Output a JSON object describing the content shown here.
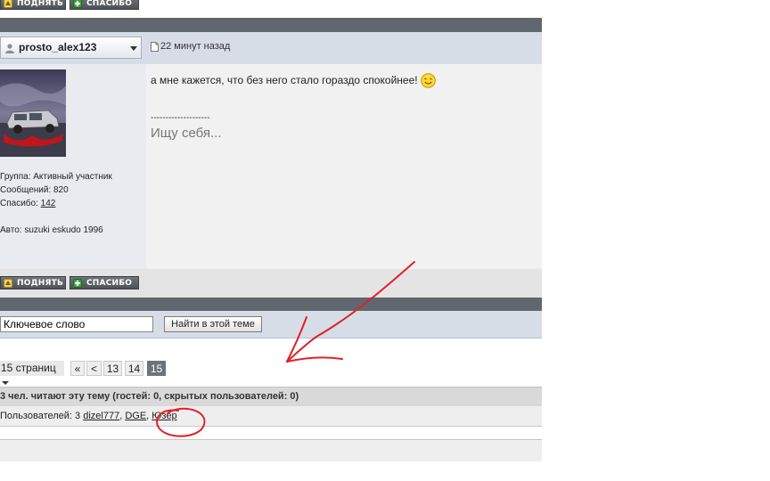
{
  "post_top": {
    "raise_label": "ПОДНЯТЬ",
    "thanks_label": "СПАСИБО"
  },
  "post": {
    "author": "prosto_alex123",
    "time": "22 минут назад",
    "text": "а мне кажется, что без него стало гораздо спокойнее!",
    "signature_divider": "--------------------",
    "signature": "Ищу себя...",
    "author_info": {
      "group": "Группа: Активный участник",
      "messages": "Сообщений: 820",
      "thanks_prefix": "Спасибо: ",
      "thanks_count": "142",
      "auto": "Авто: suzuki eskudo 1996"
    },
    "raise_label": "ПОДНЯТЬ",
    "thanks_label": "СПАСИБО"
  },
  "search": {
    "value": "Ключевое слово",
    "button_label": "Найти в этой теме"
  },
  "pagination": {
    "pages_label": "15 страниц",
    "first": "«",
    "prev": "<",
    "pages": [
      "13",
      "14",
      "15"
    ],
    "current": "15"
  },
  "readers": {
    "heading": "3 чел. читают эту тему (гостей: 0, скрытых пользователей: 0)",
    "users_label": "Пользователей: 3",
    "users": [
      "dizel777",
      "DGE",
      "Юзер"
    ],
    "separator": ", "
  },
  "colors": {
    "dark_bar": "#60676e",
    "light_bar": "#d6dde6",
    "post_bg": "#f1f1f1",
    "annotation": "#e0202a"
  }
}
